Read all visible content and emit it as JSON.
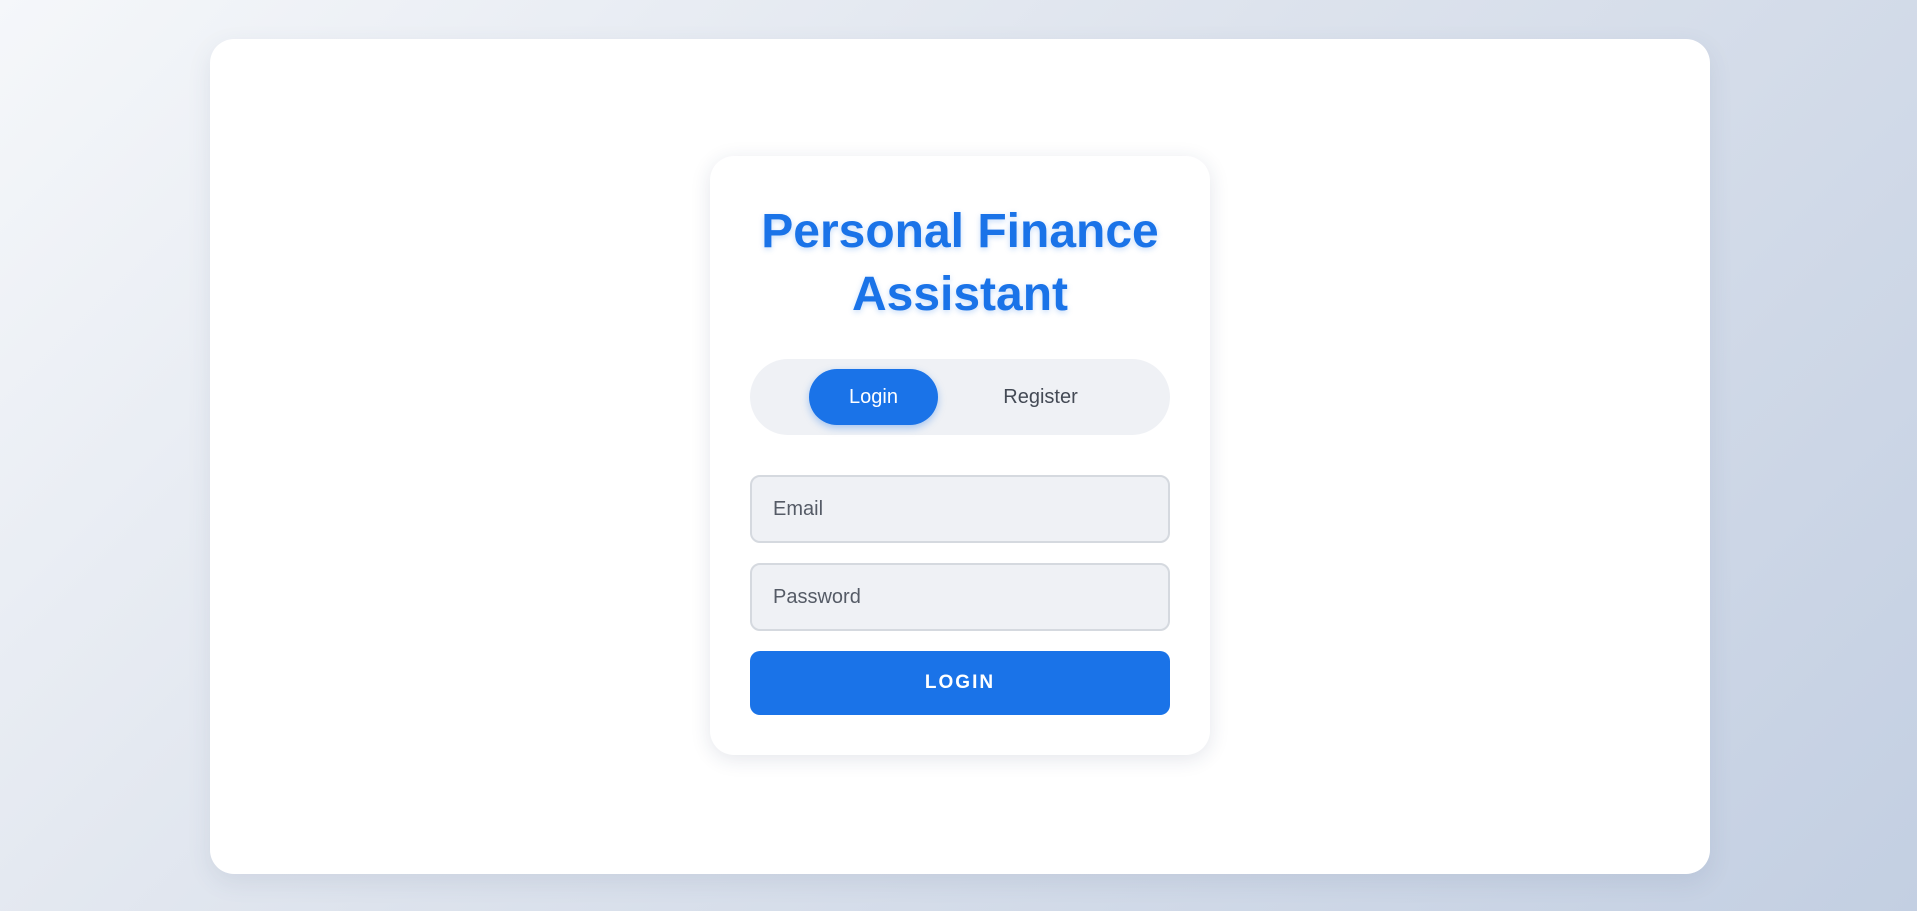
{
  "app": {
    "title": "Personal Finance Assistant"
  },
  "auth_toggle": {
    "active": "Login",
    "tabs": [
      {
        "label": "Login"
      },
      {
        "label": "Register"
      }
    ]
  },
  "form": {
    "email": {
      "placeholder": "Email",
      "value": ""
    },
    "password": {
      "placeholder": "Password",
      "value": ""
    },
    "submit_label": "LOGIN"
  },
  "colors": {
    "accent": "#1a73e8",
    "toggle_bg": "#eff1f5",
    "input_bg": "#eff1f5",
    "input_border": "#d5d9df"
  }
}
